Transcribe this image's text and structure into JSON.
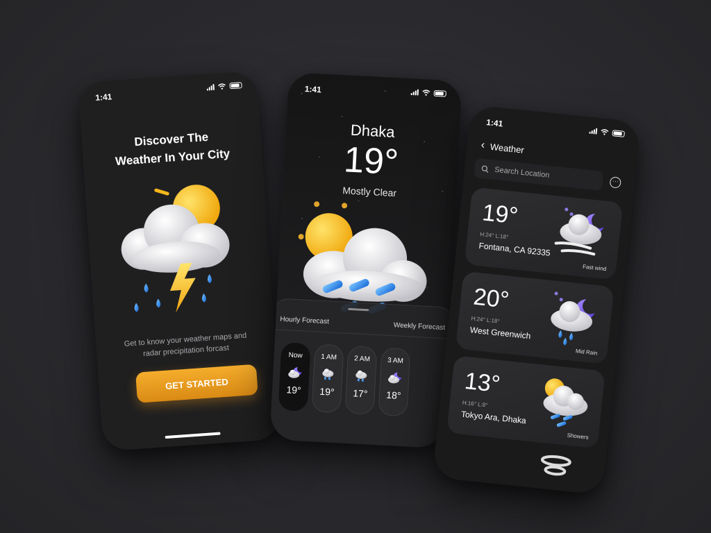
{
  "status": {
    "time": "1:41"
  },
  "onboarding": {
    "title_line1": "Discover The",
    "title_line2": "Weather In Your City",
    "description": "Get to know your weather maps and radar precipitation forcast",
    "cta_label": "GET STARTED",
    "illustration": "thunderstorm-sun-icon"
  },
  "current": {
    "city": "Dhaka",
    "temperature": "19°",
    "condition": "Mostly Clear",
    "illustration": "sun-rain-cloud-icon",
    "tabs": [
      "Hourly Forecast",
      "Weekly Forecast"
    ],
    "hourly": [
      {
        "label": "Now",
        "temp": "19°",
        "icon": "cloud-moon-icon"
      },
      {
        "label": "1 AM",
        "temp": "19°",
        "icon": "rain-cloud-icon"
      },
      {
        "label": "2 AM",
        "temp": "17°",
        "icon": "rain-cloud-icon"
      },
      {
        "label": "3 AM",
        "temp": "18°",
        "icon": "cloud-moon-icon"
      }
    ]
  },
  "locations": {
    "header": "Weather",
    "search_placeholder": "Search Location",
    "cards": [
      {
        "temp": "19°",
        "hl": "H:24°  L:18°",
        "location": "Fontana, CA 92335",
        "label": "Fast wind",
        "icon": "windy-moon-icon"
      },
      {
        "temp": "20°",
        "hl": "H:24°  L:18°",
        "location": "West Greenwich",
        "label": "Mid Rain",
        "icon": "rain-moon-icon"
      },
      {
        "temp": "13°",
        "hl": "H:16°  L:8°",
        "location": "Tokyo Ara, Dhaka",
        "label": "Showers",
        "icon": "sun-showers-icon"
      }
    ]
  },
  "colors": {
    "accent": "#f0a324",
    "sun": "#f7c531",
    "rain": "#2e8ff0",
    "moon": "#7a5cf0",
    "bg": "#2a2a2e"
  }
}
